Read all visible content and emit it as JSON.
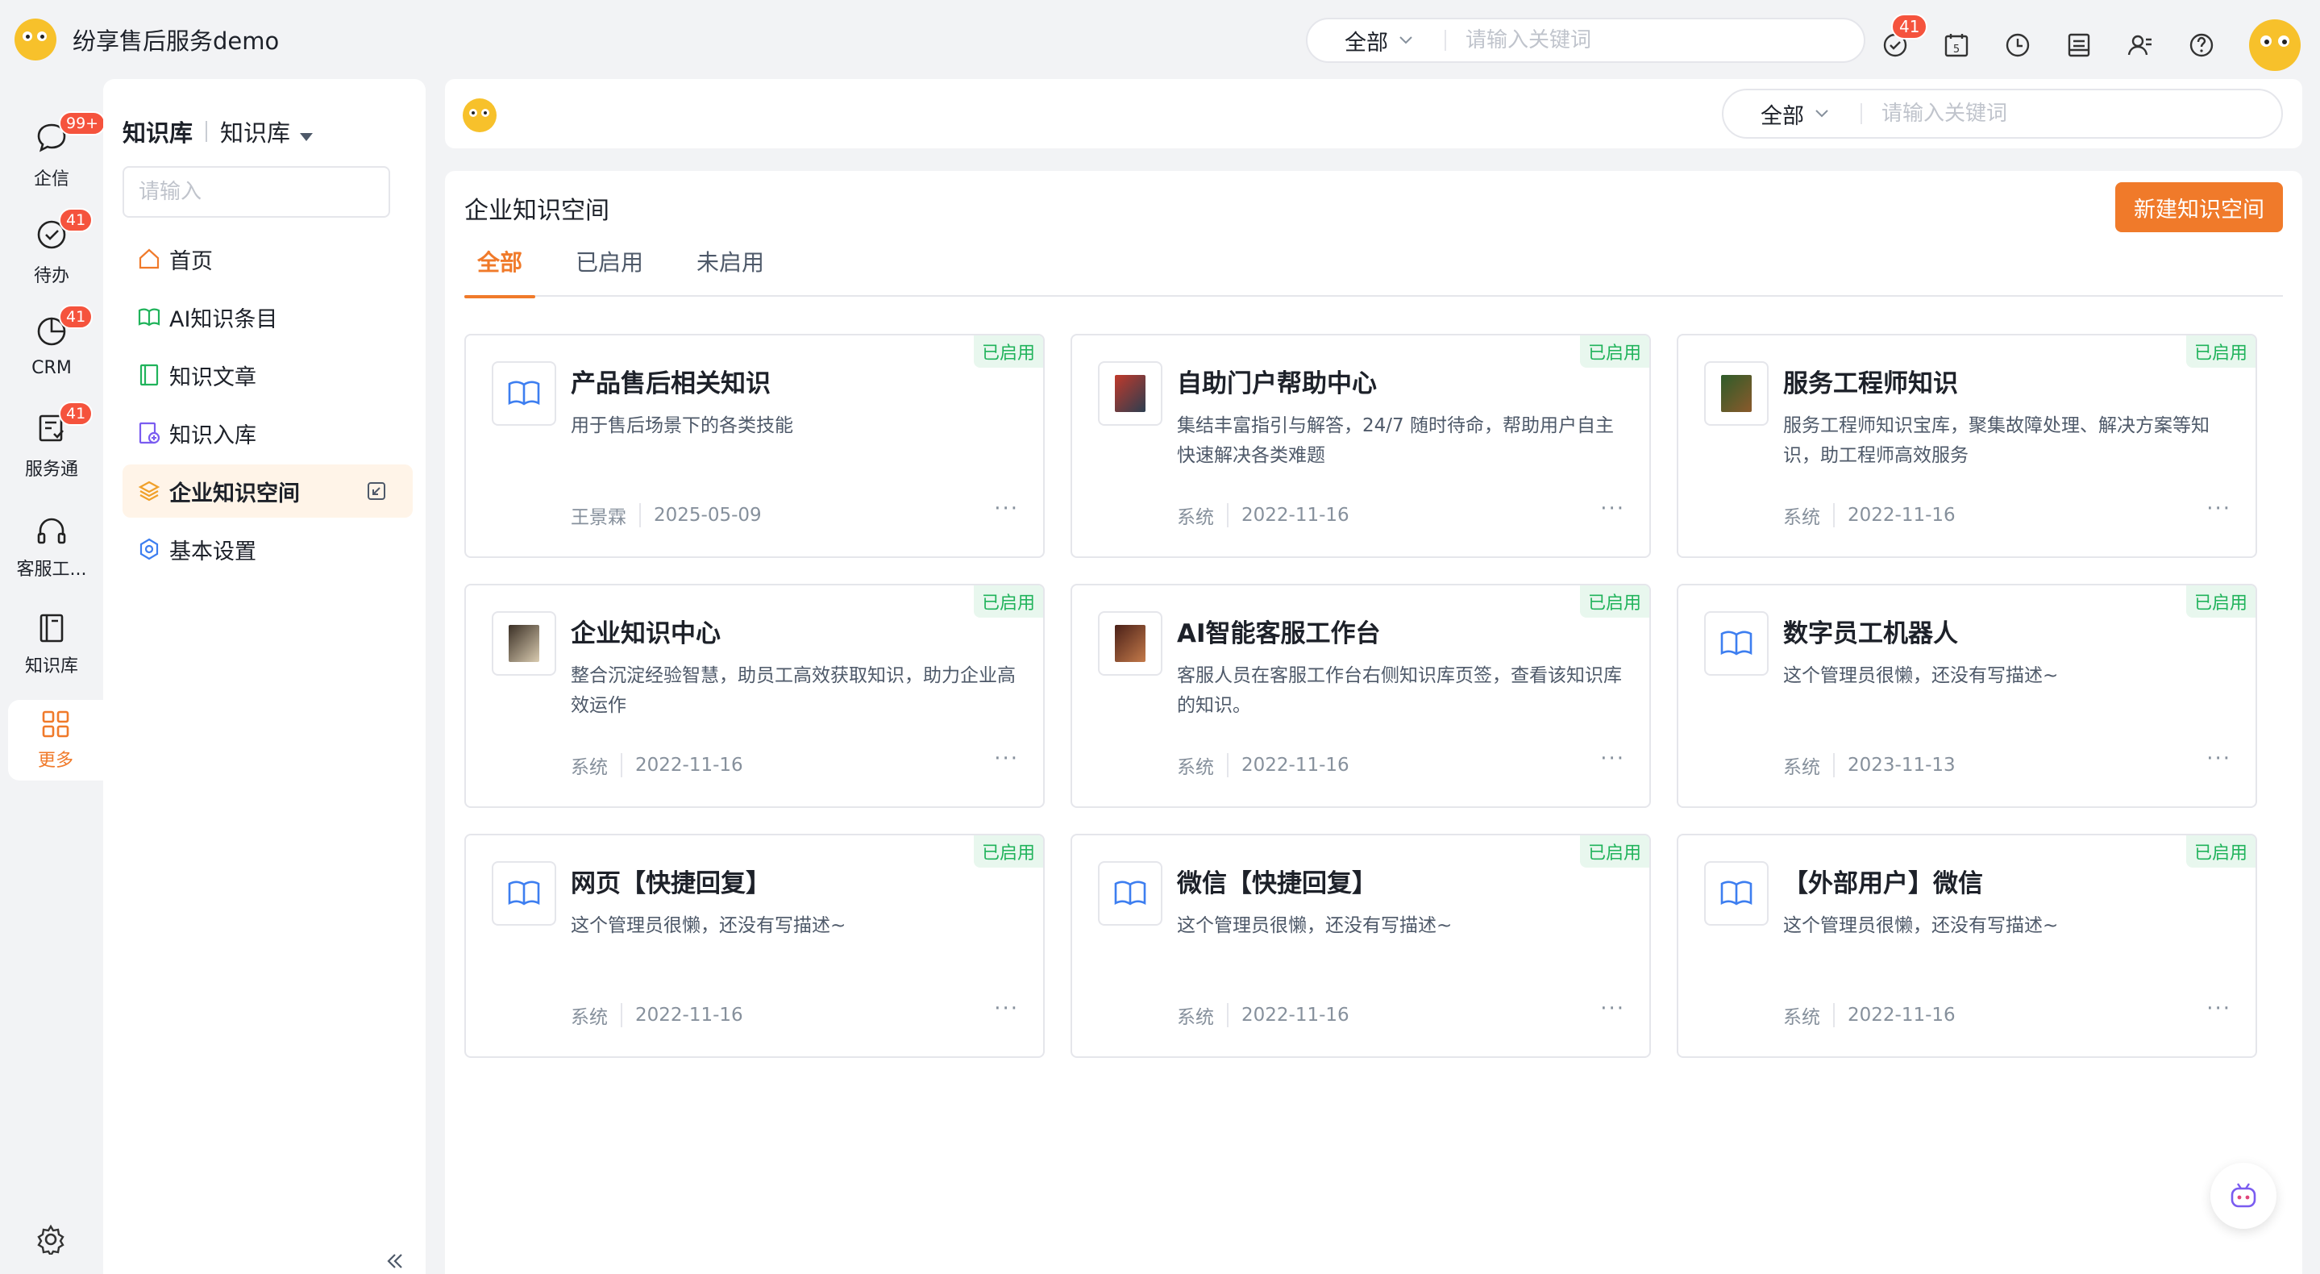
{
  "app": {
    "title": "纷享售后服务demo"
  },
  "top_search": {
    "scope": "全部",
    "placeholder": "请输入关键词"
  },
  "top_icons": [
    {
      "icon": "task-check-icon",
      "badge": "41"
    },
    {
      "icon": "calendar-icon",
      "badge": "",
      "glyph": "5"
    },
    {
      "icon": "clock-icon",
      "badge": ""
    },
    {
      "icon": "inbox-icon",
      "badge": ""
    },
    {
      "icon": "contacts-icon",
      "badge": ""
    },
    {
      "icon": "help-icon",
      "badge": ""
    }
  ],
  "rail": {
    "items": [
      {
        "label": "企信",
        "badge": "99+",
        "icon": "chat-icon"
      },
      {
        "label": "待办",
        "badge": "41",
        "icon": "todo-icon"
      },
      {
        "label": "CRM",
        "badge": "41",
        "icon": "crm-icon"
      },
      {
        "label": "服务通",
        "badge": "41",
        "icon": "service-icon"
      },
      {
        "label": "客服工...",
        "badge": "",
        "icon": "headset-icon"
      },
      {
        "label": "知识库",
        "badge": "",
        "icon": "knowledge-icon"
      }
    ],
    "more_label": "更多"
  },
  "sidenav": {
    "title": "知识库",
    "switcher": "知识库",
    "search_placeholder": "请输入",
    "items": [
      {
        "label": "首页",
        "icon": "home-icon"
      },
      {
        "label": "AI知识条目",
        "icon": "book-open-icon"
      },
      {
        "label": "知识文章",
        "icon": "article-icon"
      },
      {
        "label": "知识入库",
        "icon": "import-icon"
      },
      {
        "label": "企业知识空间",
        "icon": "layers-icon",
        "active": true
      },
      {
        "label": "基本设置",
        "icon": "settings-icon"
      }
    ]
  },
  "subheader": {
    "scope": "全部",
    "placeholder": "请输入关键词"
  },
  "main": {
    "title": "企业知识空间",
    "new_button": "新建知识空间",
    "tabs": [
      {
        "label": "全部",
        "active": true
      },
      {
        "label": "已启用",
        "active": false
      },
      {
        "label": "未启用",
        "active": false
      }
    ],
    "cards": [
      {
        "title": "产品售后相关知识",
        "desc": "用于售后场景下的各类技能",
        "author": "王景霖",
        "date": "2025-05-09",
        "status": "已启用",
        "icon": "book-icon"
      },
      {
        "title": "自助门户帮助中心",
        "desc": "集结丰富指引与解答，24/7 随时待命，帮助用户自主快速解决各类难题",
        "author": "系统",
        "date": "2022-11-16",
        "status": "已启用",
        "icon": "image-thumb"
      },
      {
        "title": "服务工程师知识",
        "desc": "服务工程师知识宝库，聚集故障处理、解决方案等知识，助工程师高效服务",
        "author": "系统",
        "date": "2022-11-16",
        "status": "已启用",
        "icon": "image-thumb"
      },
      {
        "title": "企业知识中心",
        "desc": "整合沉淀经验智慧，助员工高效获取知识，助力企业高效运作",
        "author": "系统",
        "date": "2022-11-16",
        "status": "已启用",
        "icon": "image-thumb"
      },
      {
        "title": "AI智能客服工作台",
        "desc": "客服人员在客服工作台右侧知识库页签，查看该知识库的知识。",
        "author": "系统",
        "date": "2022-11-16",
        "status": "已启用",
        "icon": "image-thumb"
      },
      {
        "title": "数字员工机器人",
        "desc": "这个管理员很懒，还没有写描述~",
        "author": "系统",
        "date": "2023-11-13",
        "status": "已启用",
        "icon": "book-icon"
      },
      {
        "title": "网页【快捷回复】",
        "desc": "这个管理员很懒，还没有写描述~",
        "author": "系统",
        "date": "2022-11-16",
        "status": "已启用",
        "icon": "book-icon"
      },
      {
        "title": "微信【快捷回复】",
        "desc": "这个管理员很懒，还没有写描述~",
        "author": "系统",
        "date": "2022-11-16",
        "status": "已启用",
        "icon": "book-icon"
      },
      {
        "title": "【外部用户】微信",
        "desc": "这个管理员很懒，还没有写描述~",
        "author": "系统",
        "date": "2022-11-16",
        "status": "已启用",
        "icon": "book-icon"
      }
    ]
  },
  "colors": {
    "accent": "#f07a2a",
    "enabled_green": "#20b35b",
    "badge_red": "#f5533d"
  }
}
